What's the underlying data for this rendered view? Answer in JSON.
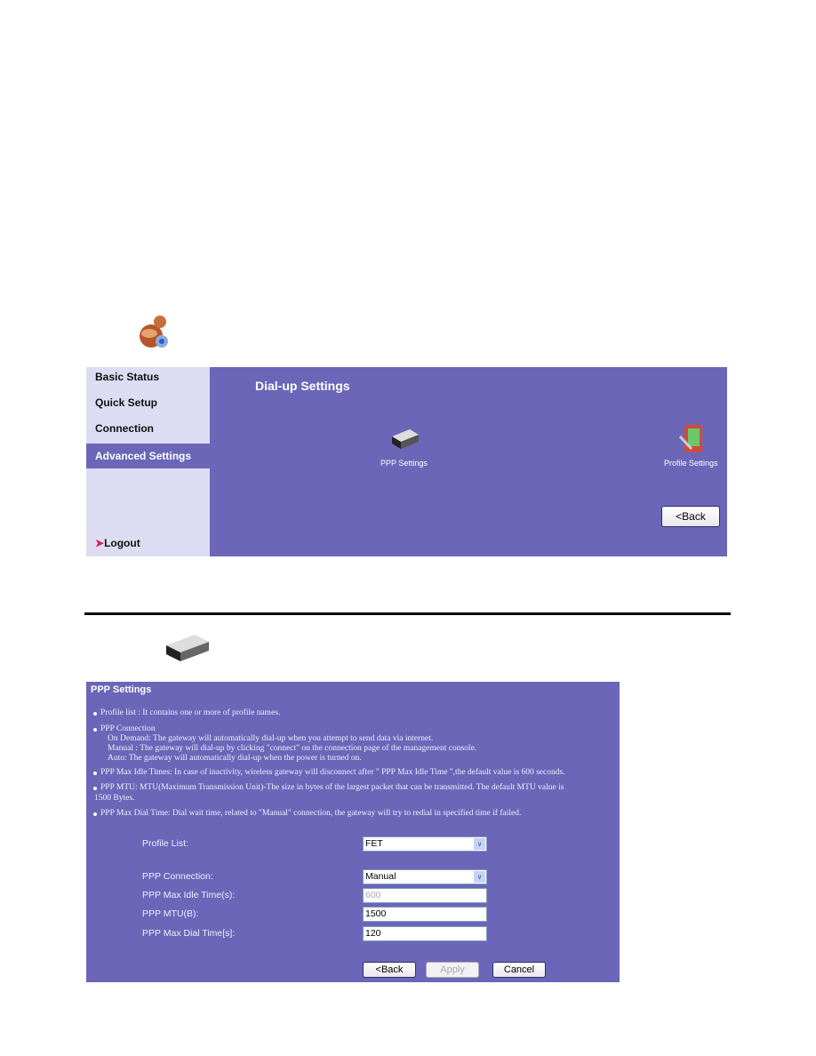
{
  "top": {
    "sidebar": [
      {
        "label": "Basic Status",
        "active": false
      },
      {
        "label": "Quick Setup",
        "active": false
      },
      {
        "label": "Connection",
        "active": false
      },
      {
        "label": "Advanced Settings",
        "active": true
      }
    ],
    "logout_label": "Logout",
    "title": "Dial-up Settings",
    "icons": [
      {
        "label": "PPP Settings",
        "icon": "modem-icon"
      },
      {
        "label": "Profile Settings",
        "icon": "pda-tools-icon"
      }
    ],
    "back_label": "<Back"
  },
  "bottom": {
    "title": "PPP Settings",
    "help": [
      "Profile list : It contains one or more of profile names.",
      "PPP Connection",
      "On Demand: The gateway will automatically dial-up when you attempt to send data via internet.",
      "Manual : The gateway will dial-up by clicking \"connect\" on the connection page of the management console.",
      "Auto: The gateway will automatically dial-up when the power is turned on.",
      "PPP Max Idle Times: In case of inactivity, wireless gateway will disconnect after \" PPP Max Idle Time \",the default value is 600 seconds.",
      "PPP MTU: MTU(Maximum Transmission Unit)-The size in bytes of the largest packet that can be transmitted. The default MTU value is",
      "1500 Bytes.",
      "PPP Max Dial Time: Dial wait time, related to \"Manual\" connection, the gateway will try to redial in specified time if failed."
    ],
    "fields": {
      "profile_list": {
        "label": "Profile List:",
        "value": "FET"
      },
      "ppp_connection": {
        "label": "PPP Connection:",
        "value": "Manual"
      },
      "max_idle": {
        "label": "PPP Max Idle Time(s):",
        "value": "600",
        "disabled": true
      },
      "mtu": {
        "label": "PPP MTU(B):",
        "value": "1500"
      },
      "max_dial": {
        "label": "PPP Max Dial Time[s]:",
        "value": "120"
      }
    },
    "buttons": {
      "back": "<Back",
      "apply": "Apply",
      "cancel": "Cancel"
    }
  },
  "colors": {
    "panel": "#6b66b8",
    "sidebar": "#dcdcf2"
  }
}
